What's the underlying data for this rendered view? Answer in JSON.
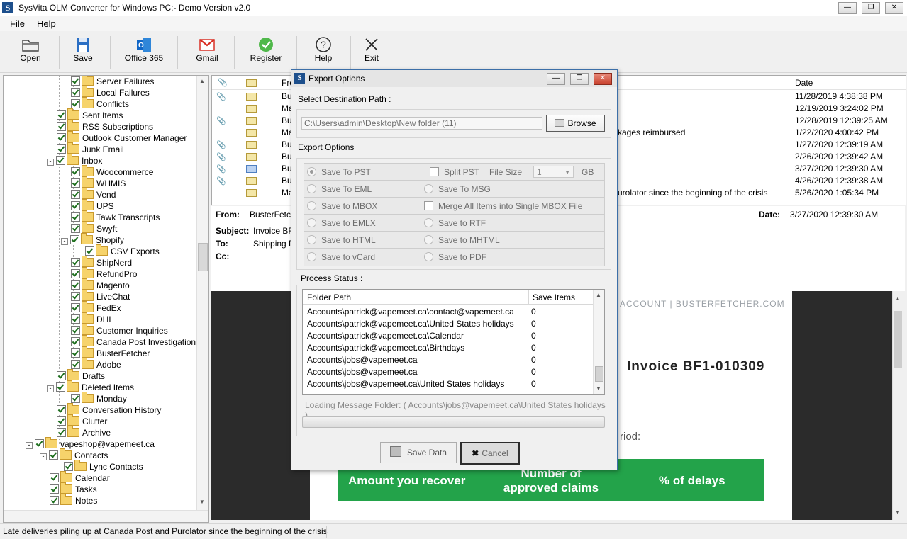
{
  "window": {
    "title": "SysVita OLM Converter for Windows PC:- Demo Version v2.0",
    "icon_letter": "S"
  },
  "menu": [
    "File",
    "Help"
  ],
  "toolbar": [
    {
      "label": "Open",
      "icon": "folder-open-icon"
    },
    {
      "label": "Save",
      "icon": "save-icon"
    },
    {
      "label": "Office 365",
      "icon": "office365-icon"
    },
    {
      "label": "Gmail",
      "icon": "gmail-icon"
    },
    {
      "label": "Register",
      "icon": "register-check-icon"
    },
    {
      "label": "Help",
      "icon": "help-icon"
    },
    {
      "label": "Exit",
      "icon": "exit-icon"
    }
  ],
  "tree": [
    {
      "label": "Server Failures"
    },
    {
      "label": "Local Failures"
    },
    {
      "label": "Conflicts"
    },
    {
      "label": "Sent Items"
    },
    {
      "label": "RSS Subscriptions"
    },
    {
      "label": "Outlook Customer Manager"
    },
    {
      "label": "Junk Email"
    },
    {
      "label": "Inbox"
    },
    {
      "label": "Woocommerce"
    },
    {
      "label": "WHMIS"
    },
    {
      "label": "Vend"
    },
    {
      "label": "UPS"
    },
    {
      "label": "Tawk Transcripts"
    },
    {
      "label": "Swyft"
    },
    {
      "label": "Shopify"
    },
    {
      "label": "CSV Exports"
    },
    {
      "label": "ShipNerd"
    },
    {
      "label": "RefundPro"
    },
    {
      "label": "Magento"
    },
    {
      "label": "LiveChat"
    },
    {
      "label": "FedEx"
    },
    {
      "label": "DHL"
    },
    {
      "label": "Customer Inquiries"
    },
    {
      "label": "Canada Post Investigations"
    },
    {
      "label": "BusterFetcher"
    },
    {
      "label": "Adobe"
    },
    {
      "label": "Drafts"
    },
    {
      "label": "Deleted Items"
    },
    {
      "label": "Monday"
    },
    {
      "label": "Conversation History"
    },
    {
      "label": "Clutter"
    },
    {
      "label": "Archive"
    },
    {
      "label": "vapeshop@vapemeet.ca"
    },
    {
      "label": "Contacts"
    },
    {
      "label": "Lync Contacts"
    },
    {
      "label": "Calendar"
    },
    {
      "label": "Tasks"
    },
    {
      "label": "Notes"
    }
  ],
  "mail_list": {
    "columns": {
      "from": "Fro",
      "date": "Date"
    },
    "rows": [
      {
        "from": "Bu",
        "subject": "",
        "date": "11/28/2019 4:38:38 PM",
        "attach": true
      },
      {
        "from": "Ma",
        "subject": "",
        "date": "12/19/2019 3:24:02 PM",
        "attach": false
      },
      {
        "from": "Bu",
        "subject": "",
        "date": "12/28/2019 12:39:25 AM",
        "attach": true
      },
      {
        "from": "Ma",
        "subject": "kages reimbursed",
        "date": "1/22/2020 4:00:42 PM",
        "attach": false
      },
      {
        "from": "Bu",
        "subject": "",
        "date": "1/27/2020 12:39:19 AM",
        "attach": true
      },
      {
        "from": "Bu",
        "subject": "",
        "date": "2/26/2020 12:39:42 AM",
        "attach": true
      },
      {
        "from": "Bu",
        "subject": "",
        "date": "3/27/2020 12:39:30 AM",
        "attach": true
      },
      {
        "from": "Bu",
        "subject": "",
        "date": "4/26/2020 12:39:38 AM",
        "attach": true
      },
      {
        "from": "Ma",
        "subject": "urolator since the beginning of the crisis",
        "date": "5/26/2020 1:05:34 PM",
        "attach": false
      }
    ]
  },
  "preview": {
    "from_label": "From:",
    "from_value": "BusterFetch",
    "subject_label": "Subject:",
    "subject_value": "Invoice BF",
    "to_label": "To:",
    "to_value": "Shipping D",
    "cc_label": "Cc:",
    "date_label": "Date:",
    "date_value": "3/27/2020 12:39:30 AM",
    "header_links": "ACCOUNT  |  BUSTERFETCHER.COM",
    "invoice_title": "Invoice BF1-010309",
    "period_text": "riod:",
    "table_headers": [
      "Amount you recover",
      "Number of approved claims",
      "% of delays"
    ]
  },
  "status_bar": "Late deliveries piling up at Canada Post and Purolator since the beginning of the crisis",
  "dialog": {
    "title": "Export Options",
    "dest_label": "Select Destination Path :",
    "dest_path": "C:\\Users\\admin\\Desktop\\New folder (11)",
    "browse_label": "Browse",
    "export_options_label": "Export Options",
    "options": [
      {
        "label": "Save To PST",
        "selected": true
      },
      {
        "label": "Split PST",
        "checkbox": true
      },
      {
        "label": "File Size"
      },
      {
        "label": "1"
      },
      {
        "label": "GB"
      },
      {
        "label": "Save To EML"
      },
      {
        "label": "Save To MSG"
      },
      {
        "label": "Save to MBOX"
      },
      {
        "label": "Merge All Items into Single MBOX File",
        "checkbox": true
      },
      {
        "label": "Save to EMLX"
      },
      {
        "label": "Save to RTF"
      },
      {
        "label": "Save to HTML"
      },
      {
        "label": "Save to MHTML"
      },
      {
        "label": "Save to vCard"
      },
      {
        "label": "Save to PDF"
      }
    ],
    "process_status_label": "Process Status :",
    "grid_headers": [
      "Folder Path",
      "Save Items"
    ],
    "grid_rows": [
      {
        "path": "Accounts\\patrick@vapemeet.ca\\contact@vapemeet.ca",
        "count": "0"
      },
      {
        "path": "Accounts\\patrick@vapemeet.ca\\United States holidays",
        "count": "0"
      },
      {
        "path": "Accounts\\patrick@vapemeet.ca\\Calendar",
        "count": "0"
      },
      {
        "path": "Accounts\\patrick@vapemeet.ca\\Birthdays",
        "count": "0"
      },
      {
        "path": "Accounts\\jobs@vapemeet.ca",
        "count": "0"
      },
      {
        "path": "Accounts\\jobs@vapemeet.ca",
        "count": "0"
      },
      {
        "path": "Accounts\\jobs@vapemeet.ca\\United States holidays",
        "count": "0"
      }
    ],
    "loading_text": "Loading Message Folder: ( Accounts\\jobs@vapemeet.ca\\United States holidays )",
    "save_data_label": "Save Data",
    "cancel_label": "Cancel"
  }
}
